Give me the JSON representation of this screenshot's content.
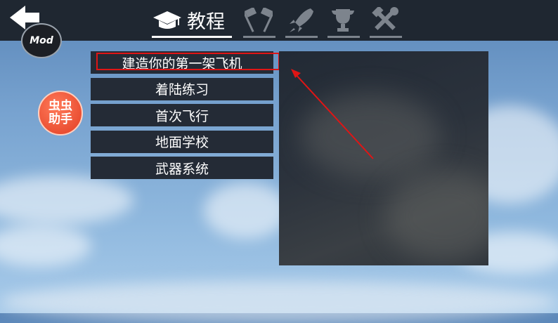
{
  "header": {
    "mod_label": "Mod",
    "tabs": [
      {
        "label": "教程",
        "icon": "graduation-cap-icon",
        "active": true
      },
      {
        "label": "",
        "icon": "crossed-flags-icon",
        "active": false
      },
      {
        "label": "",
        "icon": "rocket-icon",
        "active": false
      },
      {
        "label": "",
        "icon": "trophy-icon",
        "active": false
      },
      {
        "label": "",
        "icon": "tools-icon",
        "active": false
      }
    ]
  },
  "helper": {
    "label": "虫虫助手"
  },
  "menu": {
    "items": [
      {
        "label": "建造你的第一架飞机"
      },
      {
        "label": "着陆练习"
      },
      {
        "label": "首次飞行"
      },
      {
        "label": "地面学校"
      },
      {
        "label": "武器系统"
      }
    ]
  },
  "colors": {
    "highlight": "#e01515",
    "panel": "#242b36",
    "topbar": "#1f2731"
  }
}
